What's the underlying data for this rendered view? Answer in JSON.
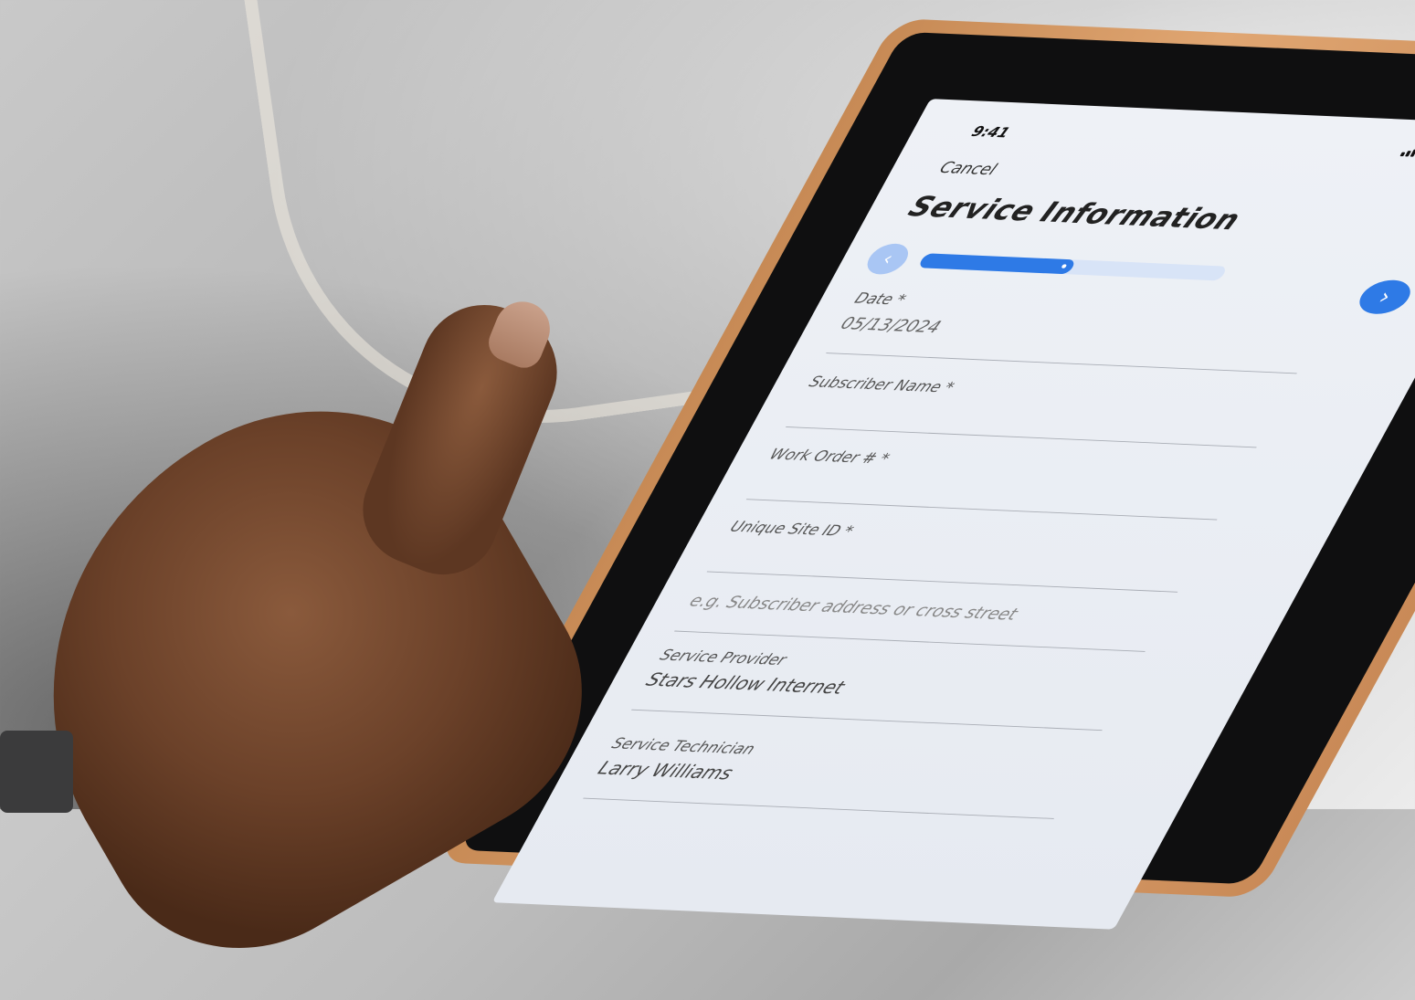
{
  "status_bar": {
    "time": "9:41",
    "icons": [
      "signal-icon",
      "wifi-icon",
      "battery-icon"
    ]
  },
  "header": {
    "cancel_label": "Cancel",
    "title": "Service Information"
  },
  "stepper": {
    "prev_icon": "chevron-left-icon",
    "next_icon": "chevron-right-icon",
    "progress": 0.5
  },
  "form": {
    "date": {
      "label": "Date *",
      "value": "05/13/2024"
    },
    "subscriber_name": {
      "label": "Subscriber Name *",
      "value": ""
    },
    "work_order": {
      "label": "Work Order # *",
      "value": ""
    },
    "unique_site_id": {
      "label": "Unique Site ID *",
      "placeholder": "e.g. Subscriber address or cross street"
    },
    "service_provider": {
      "label": "Service Provider",
      "value": "Stars Hollow Internet"
    },
    "service_technician": {
      "label": "Service Technician",
      "value": "Larry Williams"
    }
  },
  "colors": {
    "accent": "#2e7ae6",
    "accent_light": "#a9c6f4",
    "tablet_case": "#d99c66",
    "screen_bg": "#eef1f6"
  }
}
